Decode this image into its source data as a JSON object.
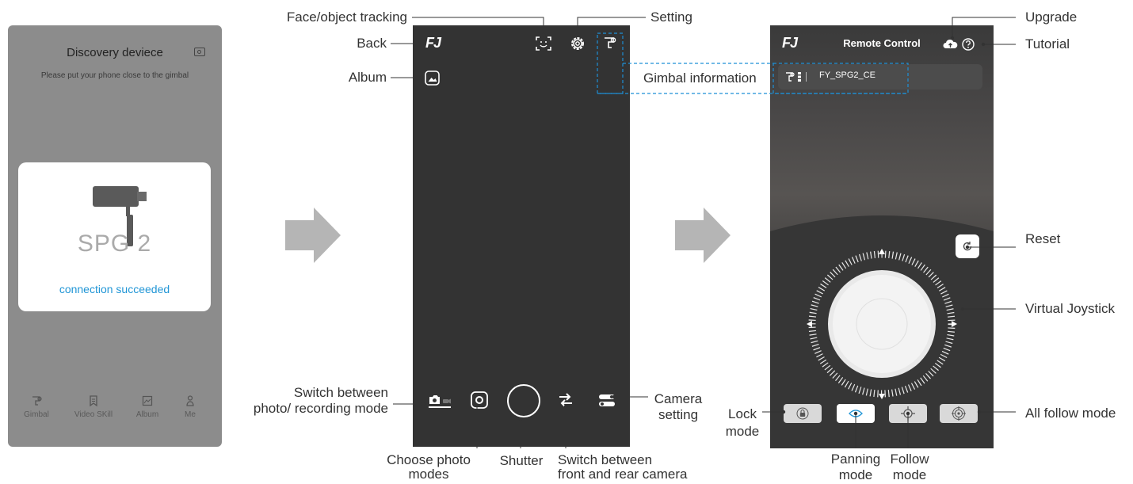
{
  "discovery_screen": {
    "title": "Discovery deviece",
    "subtitle": "Please put your phone close to the gimbal",
    "device_model": "SPG 2",
    "connection_status": "connection succeeded",
    "nav": [
      {
        "label": "Gimbal",
        "icon": "gimbal-icon"
      },
      {
        "label": "Video SKill",
        "icon": "bookmark-icon"
      },
      {
        "label": "Album",
        "icon": "album-icon"
      },
      {
        "label": "Me",
        "icon": "person-icon"
      }
    ]
  },
  "camera_screen": {
    "logo": "FJ",
    "annotations": {
      "face_tracking": "Face/object tracking",
      "setting": "Setting",
      "back": "Back",
      "album": "Album",
      "switch_mode": "Switch between\nphoto/ recording mode",
      "camera_setting": "Camera\nsetting",
      "choose_photo_modes": "Choose photo\nmodes",
      "shutter": "Shutter",
      "switch_camera": "Switch between\nfront and rear camera"
    }
  },
  "remote_screen": {
    "logo": "FJ",
    "title": "Remote Control",
    "device_name": "FY_SPG2_CE",
    "annotations": {
      "upgrade": "Upgrade",
      "tutorial": "Tutorial",
      "gimbal_information": "Gimbal information",
      "reset": "Reset",
      "virtual_joystick": "Virtual Joystick",
      "lock_mode": "Lock\nmode",
      "panning_mode": "Panning\nmode",
      "follow_mode": "Follow\nmode",
      "all_follow_mode": "All follow mode"
    },
    "modes": [
      {
        "name": "lock",
        "icon": "lock-icon",
        "active": false
      },
      {
        "name": "panning",
        "icon": "eye-icon",
        "active": true
      },
      {
        "name": "follow",
        "icon": "follow-icon",
        "active": false
      },
      {
        "name": "all-follow",
        "icon": "all-follow-icon",
        "active": false
      }
    ]
  },
  "colors": {
    "accent_blue": "#2196d6",
    "dashed_blue": "#1e90d6",
    "arrow_grey": "#b5b5b5"
  }
}
